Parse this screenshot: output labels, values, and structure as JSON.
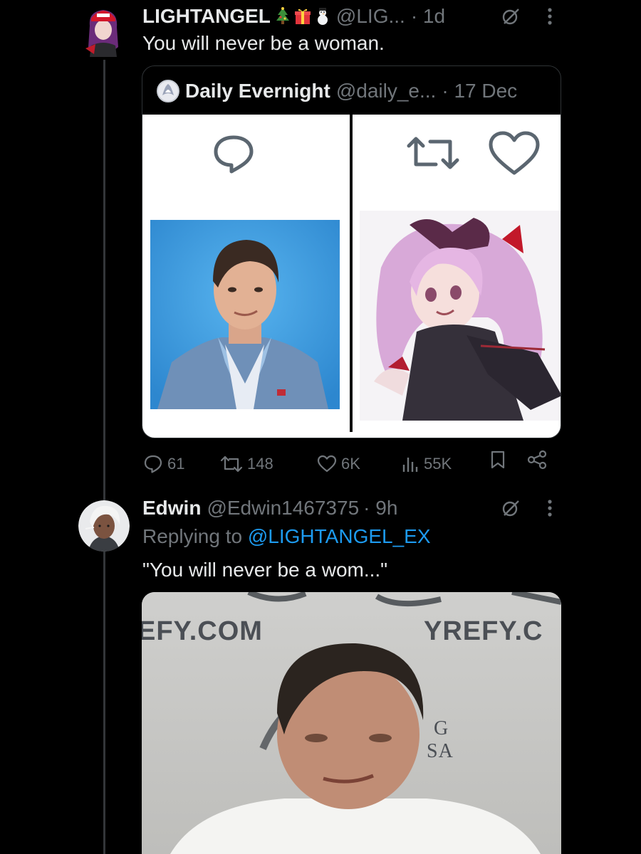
{
  "thread": {
    "tweet": {
      "display_name": "LIGHTANGEL",
      "emojis": [
        "christmas-tree-emoji",
        "gift-emoji",
        "snowman-emoji"
      ],
      "handle": "@LIG...",
      "time": "· 1d",
      "text": "You will never be a woman."
    },
    "quote": {
      "display_name": "Daily Evernight",
      "handle": "@daily_e...",
      "time": "· 17 Dec"
    },
    "actions": {
      "replies": "61",
      "reposts": "148",
      "likes": "6K",
      "views": "55K"
    },
    "reply": {
      "display_name": "Edwin",
      "handle": "@Edwin1467375",
      "time": "· 9h",
      "replying_prefix": "Replying to",
      "replying_mention": "@LIGHTANGEL_EX",
      "text": "\"You will never be a wom...\"",
      "watermark_left": "EFY.COM",
      "watermark_right": "YREFY.C",
      "watermark_logo_a": "G",
      "watermark_logo_b": "SA"
    }
  },
  "colors": {
    "background": "#000000",
    "primary_text": "#e7e9ea",
    "muted_text": "#71767b",
    "link": "#1d9bf0",
    "border": "#2f3336"
  }
}
